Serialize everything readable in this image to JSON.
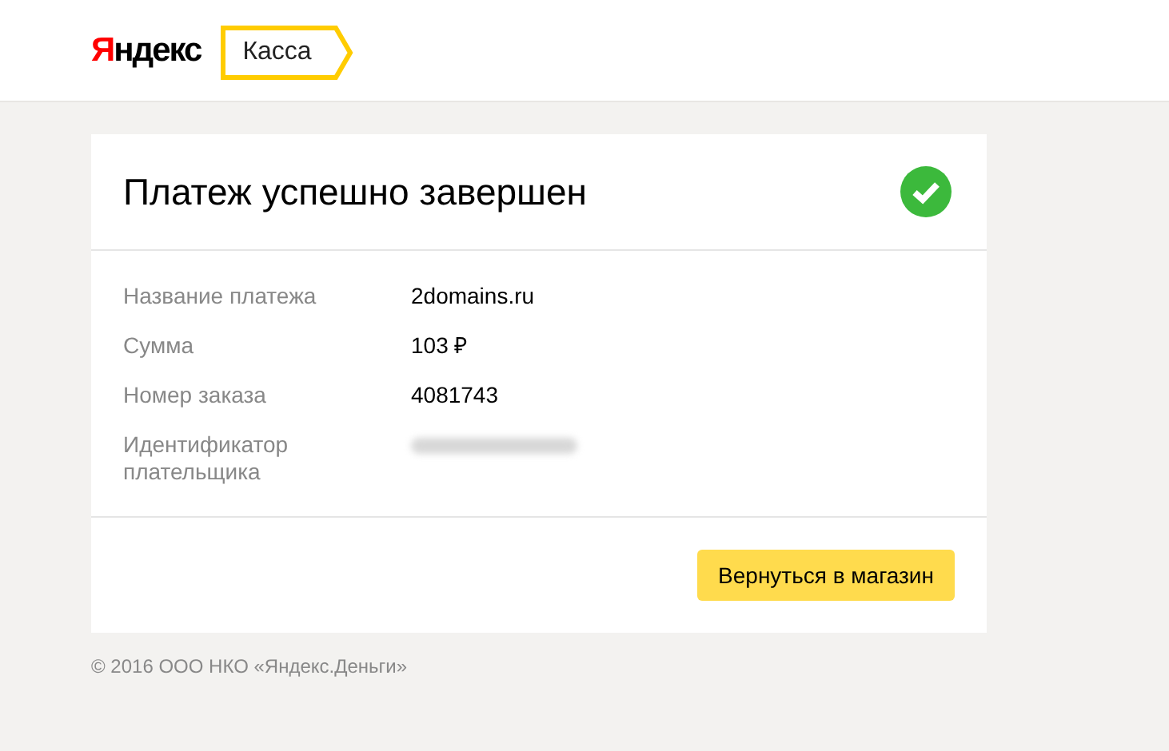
{
  "header": {
    "logo": {
      "accent": "Я",
      "rest": "ндекс"
    },
    "service": "Касса"
  },
  "card": {
    "title": "Платеж успешно завершен",
    "success": true,
    "rows": [
      {
        "label": "Название платежа",
        "kind": "text",
        "value": "2domains.ru"
      },
      {
        "label": "Сумма",
        "kind": "text",
        "value": "103 ₽"
      },
      {
        "label": "Номер заказа",
        "kind": "text",
        "value": "4081743"
      },
      {
        "label": "Идентификатор плательщика",
        "kind": "blurred"
      }
    ],
    "button": "Вернуться в магазин"
  },
  "footer": "© 2016 ООО НКО «Яндекс.Деньги»"
}
